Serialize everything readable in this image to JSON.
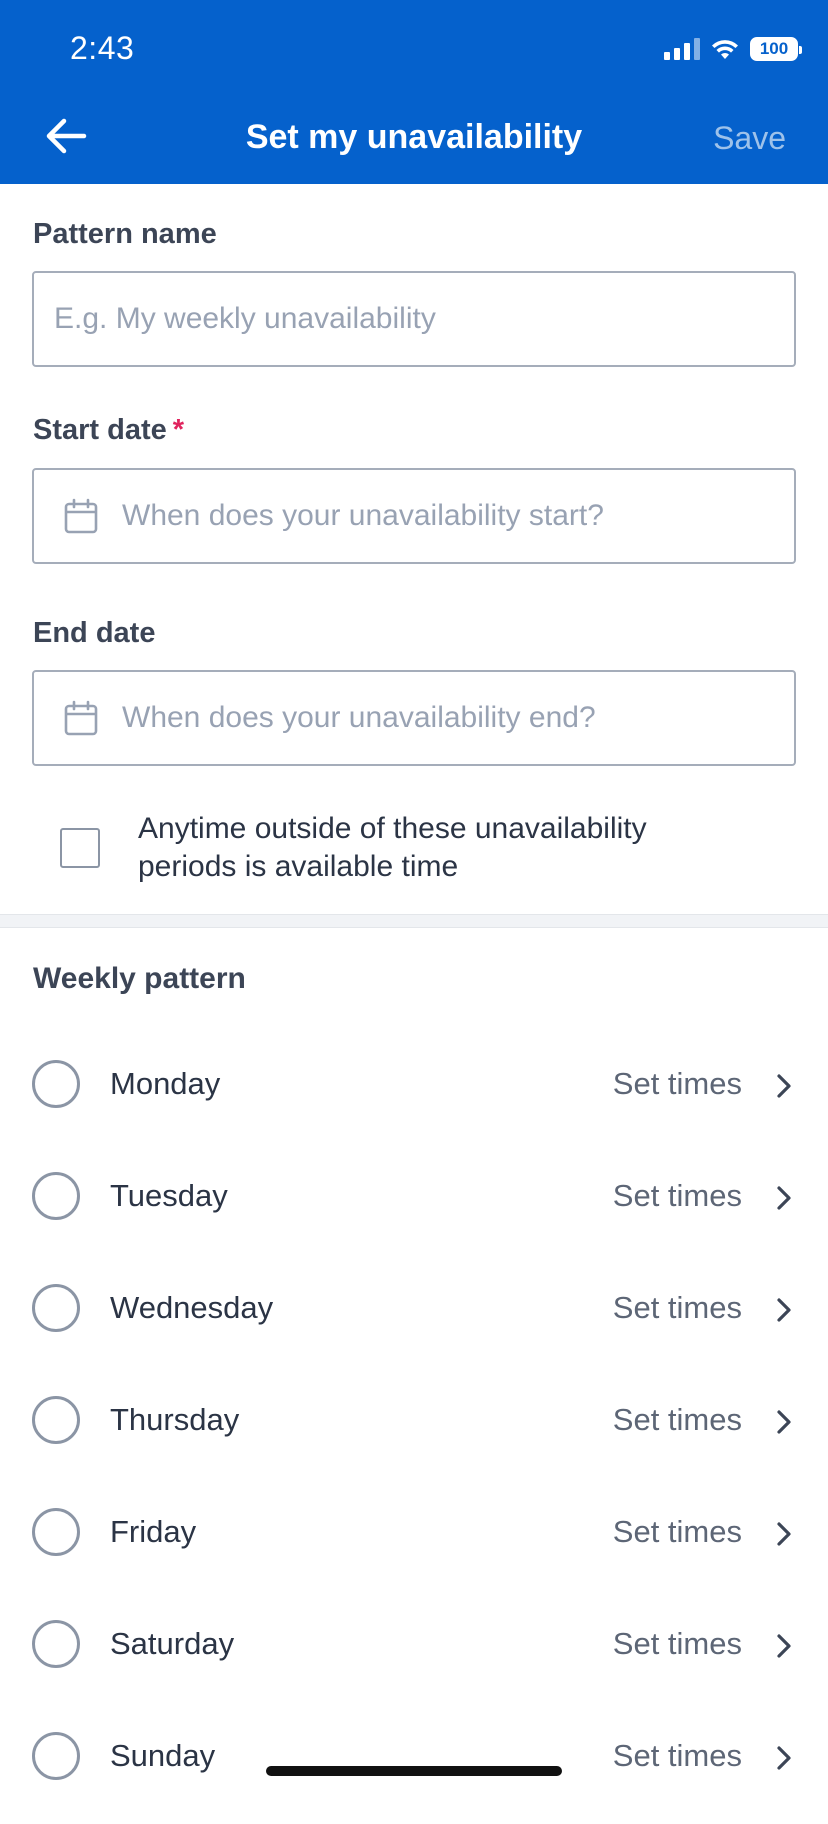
{
  "status_bar": {
    "time": "2:43",
    "battery": "100"
  },
  "nav": {
    "title": "Set my unavailability",
    "save_label": "Save"
  },
  "pattern_name": {
    "label": "Pattern name",
    "placeholder": "E.g. My weekly unavailability"
  },
  "start_date": {
    "label": "Start date",
    "required_marker": "*",
    "placeholder": "When does your unavailability start?"
  },
  "end_date": {
    "label": "End date",
    "placeholder": "When does your unavailability end?"
  },
  "available_checkbox": {
    "line1": "Anytime outside of these unavailability",
    "line2": "periods is available time"
  },
  "weekly_pattern": {
    "title": "Weekly pattern",
    "days": [
      {
        "label": "Monday",
        "action": "Set times"
      },
      {
        "label": "Tuesday",
        "action": "Set times"
      },
      {
        "label": "Wednesday",
        "action": "Set times"
      },
      {
        "label": "Thursday",
        "action": "Set times"
      },
      {
        "label": "Friday",
        "action": "Set times"
      },
      {
        "label": "Saturday",
        "action": "Set times"
      },
      {
        "label": "Sunday",
        "action": "Set times"
      }
    ]
  },
  "colors": {
    "header": "#0561cc",
    "save_disabled": "#9ec2ea",
    "required": "#e0245e"
  },
  "icons": [
    "back-arrow-icon",
    "calendar-icon",
    "chevron-right-icon",
    "wifi-icon",
    "signal-icon",
    "battery-icon"
  ]
}
